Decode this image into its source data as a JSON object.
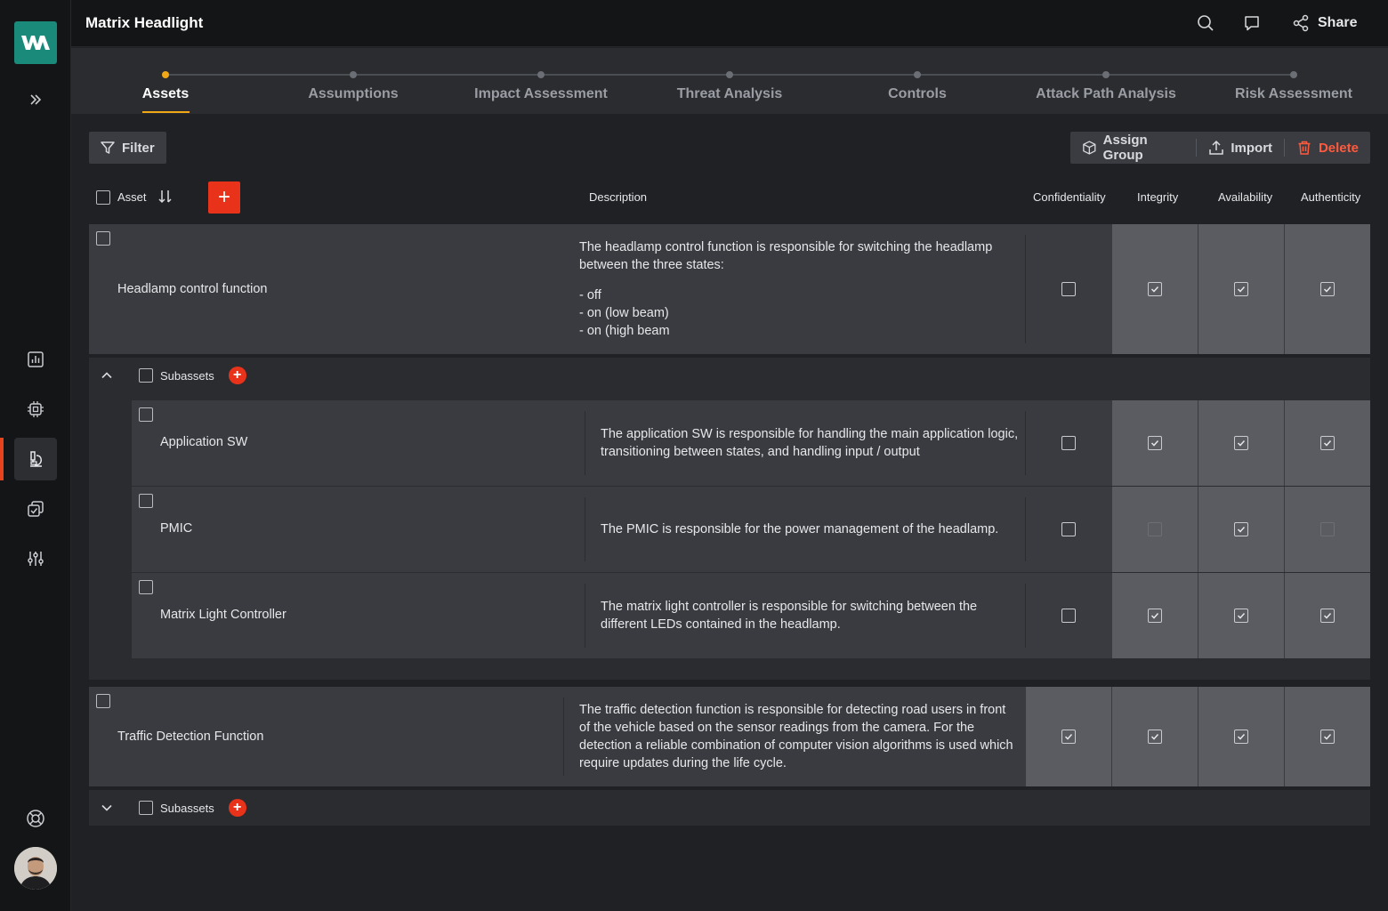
{
  "header": {
    "title": "Matrix Headlight",
    "share_label": "Share"
  },
  "tabs": [
    {
      "label": "Assets",
      "active": true
    },
    {
      "label": "Assumptions"
    },
    {
      "label": "Impact Assessment"
    },
    {
      "label": "Threat Analysis"
    },
    {
      "label": "Controls"
    },
    {
      "label": "Attack Path Analysis"
    },
    {
      "label": "Risk Assessment"
    }
  ],
  "toolbar": {
    "filter_label": "Filter",
    "assign_group_label": "Assign Group",
    "import_label": "Import",
    "delete_label": "Delete",
    "add_label": "+"
  },
  "columns": {
    "asset": "Asset",
    "description": "Description",
    "confidentiality": "Confidentiality",
    "integrity": "Integrity",
    "availability": "Availability",
    "authenticity": "Authenticity"
  },
  "assets": [
    {
      "name": "Headlamp control function",
      "description": "The headlamp control function is responsible for switching the headlamp between the three states:",
      "description_list": [
        "- off",
        "- on (low beam)",
        "- on (high beam"
      ],
      "properties": {
        "confidentiality": false,
        "integrity": true,
        "availability": true,
        "authenticity": true
      },
      "subassets_label": "Subassets",
      "subassets": [
        {
          "name": "Application SW",
          "description": "The application SW is responsible for handling the main application logic, transitioning between states, and handling input / output",
          "properties": {
            "confidentiality": false,
            "integrity": true,
            "availability": true,
            "authenticity": true
          }
        },
        {
          "name": "PMIC",
          "description": "The PMIC is responsible for the power management of the headlamp.",
          "properties": {
            "confidentiality": false,
            "integrity": false,
            "availability": true,
            "authenticity": false
          }
        },
        {
          "name": "Matrix Light Controller",
          "description": "The matrix light controller is responsible for switching between the different LEDs contained in the headlamp.",
          "properties": {
            "confidentiality": false,
            "integrity": true,
            "availability": true,
            "authenticity": true
          }
        }
      ]
    },
    {
      "name": "Traffic Detection Function",
      "description": "The traffic detection function is responsible for detecting road users in front of the vehicle based on the sensor readings from the camera. For the detection a reliable combination of computer vision algorithms is used which require updates during the life cycle.",
      "properties": {
        "confidentiality": true,
        "integrity": true,
        "availability": true,
        "authenticity": true
      },
      "subassets_label": "Subassets"
    }
  ],
  "icons": {
    "logo": "wm-logo",
    "accent_color": "#e8331a",
    "active_tab_color": "#f1a816"
  }
}
